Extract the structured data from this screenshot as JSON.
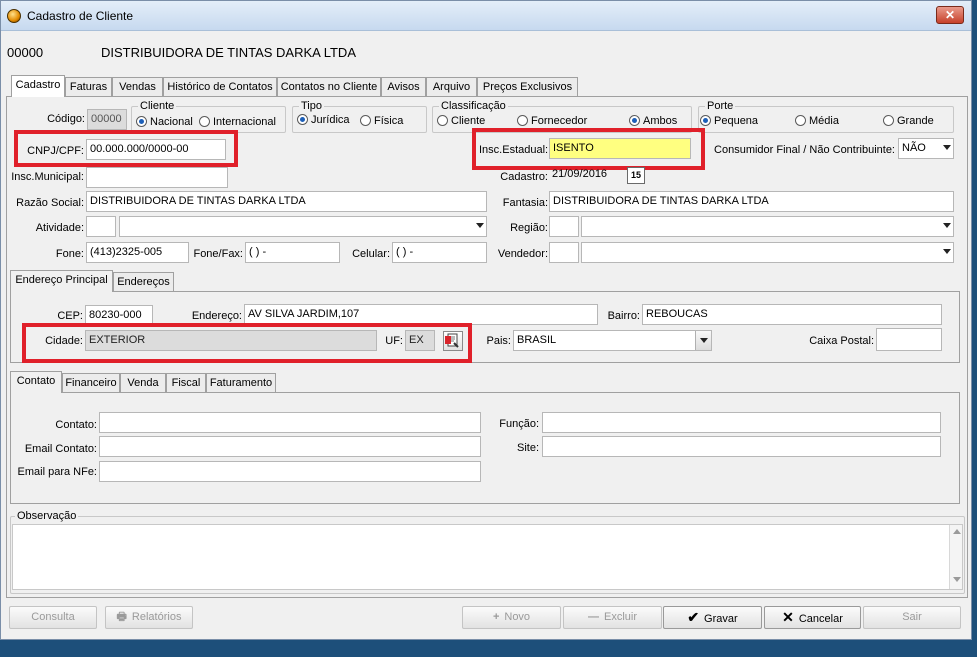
{
  "window": {
    "title": "Cadastro de Cliente",
    "close_glyph": "✕"
  },
  "header": {
    "code": "00000",
    "name": "DISTRIBUIDORA DE TINTAS DARKA LTDA"
  },
  "main_tabs": [
    "Cadastro",
    "Faturas",
    "Vendas",
    "Histórico de Contatos",
    "Contatos no Cliente",
    "Avisos",
    "Arquivo",
    "Preços Exclusivos"
  ],
  "cadastro": {
    "codigo_label": "Código:",
    "codigo_value": "00000",
    "cliente_group": {
      "legend": "Cliente",
      "options": [
        "Nacional",
        "Internacional"
      ],
      "selected": "Nacional"
    },
    "tipo_group": {
      "legend": "Tipo",
      "options": [
        "Jurídica",
        "Física"
      ],
      "selected": "Jurídica"
    },
    "classificacao_group": {
      "legend": "Classificação",
      "options": [
        "Cliente",
        "Fornecedor",
        "Ambos"
      ],
      "selected": "Ambos"
    },
    "porte_group": {
      "legend": "Porte",
      "options": [
        "Pequena",
        "Média",
        "Grande"
      ],
      "selected": "Pequena"
    },
    "cnpj_label": "CNPJ/CPF:",
    "cnpj_value": "00.000.000/0000-00",
    "insc_estadual_label": "Insc.Estadual:",
    "insc_estadual_value": "ISENTO",
    "consumidor_label": "Consumidor Final / Não Contribuinte:",
    "consumidor_value": "NÃO",
    "insc_municipal_label": "Insc.Municipal:",
    "insc_municipal_value": "",
    "cadastro_label": "Cadastro:",
    "cadastro_value": "21/09/2016",
    "calendar_glyph": "15",
    "razao_label": "Razão Social:",
    "razao_value": "DISTRIBUIDORA DE TINTAS DARKA LTDA",
    "fantasia_label": "Fantasia:",
    "fantasia_value": "DISTRIBUIDORA DE TINTAS DARKA LTDA",
    "atividade_label": "Atividade:",
    "regiao_label": "Região:",
    "fone_label": "Fone:",
    "fone_value": "(413)2325-005",
    "fonefax_label": "Fone/Fax:",
    "fonefax_value": "(  )    -",
    "celular_label": "Celular:",
    "celular_value": "(  )    -",
    "vendedor_label": "Vendedor:"
  },
  "endereco_tabs": [
    "Endereço Principal",
    "Endereços"
  ],
  "endereco": {
    "cep_label": "CEP:",
    "cep_value": "80230-000",
    "endereco_label": "Endereço:",
    "endereco_value": "AV SILVA JARDIM,107",
    "bairro_label": "Bairro:",
    "bairro_value": "REBOUCAS",
    "cidade_label": "Cidade:",
    "cidade_value": "EXTERIOR",
    "uf_label": "UF:",
    "uf_value": "EX",
    "pais_label": "Pais:",
    "pais_value": "BRASIL",
    "caixa_postal_label": "Caixa Postal:",
    "caixa_postal_value": ""
  },
  "contato_tabs": [
    "Contato",
    "Financeiro",
    "Venda",
    "Fiscal",
    "Faturamento"
  ],
  "contato": {
    "contato_label": "Contato:",
    "funcao_label": "Função:",
    "email_contato_label": "Email Contato:",
    "site_label": "Site:",
    "email_nfe_label": "Email para NFe:"
  },
  "observacao_label": "Observação",
  "buttons": {
    "consulta": "Consulta",
    "relatorios": "Relatórios",
    "novo": "Novo",
    "excluir": "Excluir",
    "gravar": "Gravar",
    "cancelar": "Cancelar",
    "sair": "Sair"
  },
  "colors": {
    "highlight_box": "#e0202a",
    "insc_estadual_bg": "#ffff80",
    "radio_selected": "#1d5fb8"
  }
}
